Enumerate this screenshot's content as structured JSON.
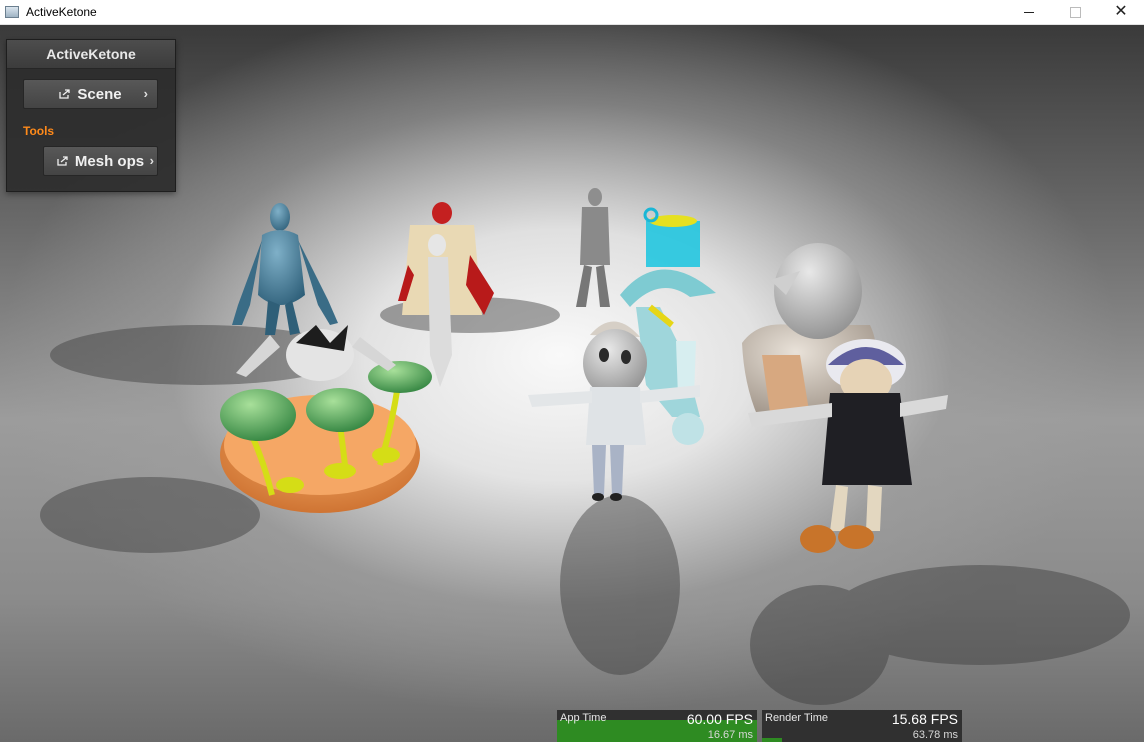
{
  "window": {
    "title": "ActiveKetone",
    "controls": {
      "minimize": "—",
      "maximize": "☐",
      "close": "✕"
    }
  },
  "panel": {
    "title": "ActiveKetone",
    "scene_button": "Scene",
    "tools_label": "Tools",
    "mesh_ops_button": "Mesh ops",
    "chevron": "›"
  },
  "perf": {
    "app": {
      "label": "App Time",
      "fps": "60.00 FPS",
      "ms": "16.67 ms",
      "load": 1.0
    },
    "render": {
      "label": "Render Time",
      "fps": "15.68 FPS",
      "ms": "63.78 ms",
      "load": 0.1
    }
  },
  "colors": {
    "accent_tools": "#ff8a1a",
    "graph_green": "#2e8b22"
  },
  "icons": [
    "app-icon",
    "export-icon",
    "chevron-right-icon"
  ]
}
